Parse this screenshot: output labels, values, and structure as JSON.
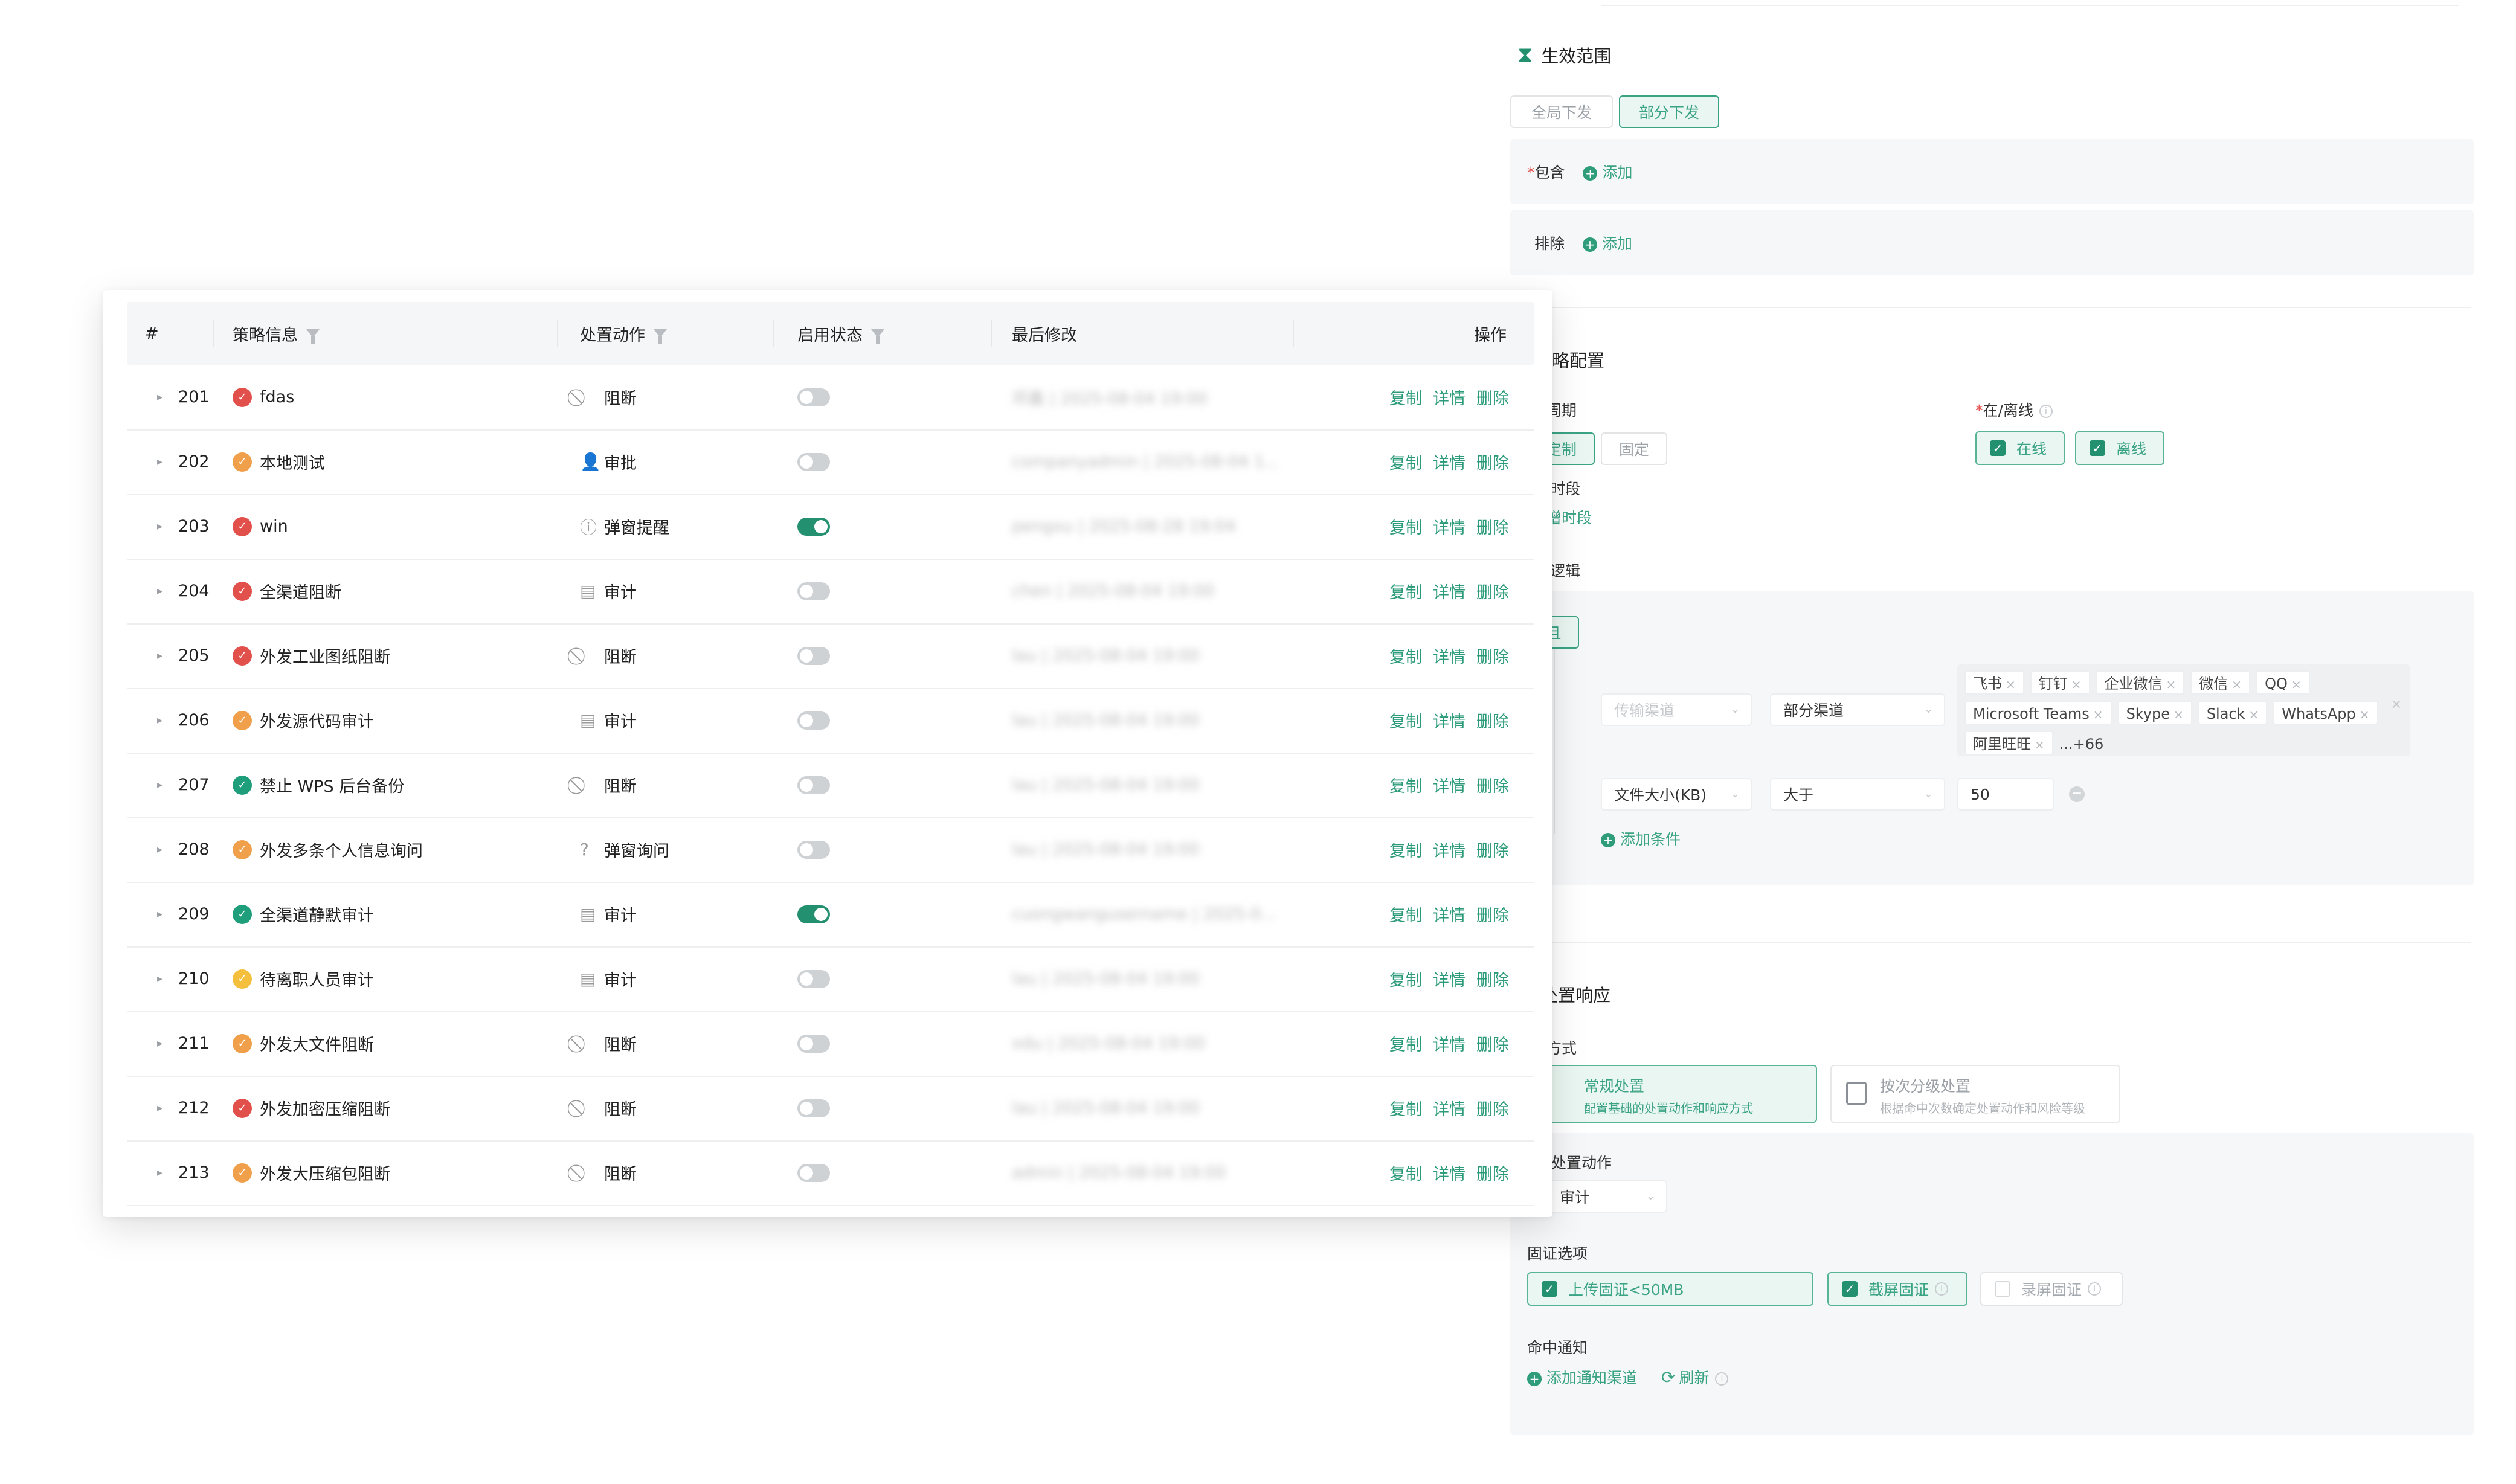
{
  "config": {
    "scope": {
      "title": "生效范围",
      "modes": [
        {
          "label": "全局下发",
          "active": false
        },
        {
          "label": "部分下发",
          "active": true
        }
      ],
      "include_label": "包含",
      "include_required": "*",
      "exclude_label": "排除",
      "add_label": "添加"
    },
    "strategy": {
      "title": "策略配置",
      "period_label": "周期",
      "period_options": [
        "定制",
        "固定"
      ],
      "online_label": "在/离线",
      "online_required": "*",
      "online_options": [
        "在线",
        "离线"
      ],
      "time_label": "时段",
      "time_add": "增时段",
      "logic_label": "逻辑",
      "logic_value": "且",
      "cond1_channel_placeholder": "传输渠道",
      "cond1_scope": "部分渠道",
      "cond1_tags": [
        "飞书",
        "钉钉",
        "企业微信",
        "微信",
        "QQ",
        "Microsoft Teams",
        "Skype",
        "Slack",
        "WhatsApp",
        "阿里旺旺"
      ],
      "cond1_more": "...+66",
      "cond2_field": "文件大小(KB)",
      "cond2_op": "大于",
      "cond2_value": "50",
      "add_condition": "添加条件"
    },
    "response": {
      "title": "处置响应",
      "method_label": "方式",
      "methods": [
        {
          "title": "常规处置",
          "desc": "配置基础的处置动作和响应方式",
          "active": true
        },
        {
          "title": "按次分级处置",
          "desc": "根据命中次数确定处置动作和风险等级",
          "active": false
        }
      ],
      "action_label": "处置动作",
      "action_value": "审计",
      "evidence_label": "固证选项",
      "evidence": [
        {
          "label": "上传固证<50MB",
          "checked": true
        },
        {
          "label": "截屏固证",
          "checked": true
        },
        {
          "label": "录屏固证",
          "checked": false
        }
      ],
      "notify_label": "命中通知",
      "notify_add": "添加通知渠道",
      "notify_refresh": "刷新"
    }
  },
  "table": {
    "headers": {
      "index": "#",
      "info": "策略信息",
      "action": "处置动作",
      "status": "启用状态",
      "modified": "最后修改",
      "ops": "操作"
    },
    "op_labels": {
      "copy": "复制",
      "detail": "详情",
      "delete": "删除"
    },
    "rows": [
      {
        "id": "201",
        "name": "fdas",
        "level": "red",
        "action": "阻断",
        "action_icon": "block-icon",
        "enabled": false,
        "modified": "邓鑫 | 2025-08-04 19:00"
      },
      {
        "id": "202",
        "name": "本地测试",
        "level": "orange",
        "action": "审批",
        "action_icon": "approval-icon",
        "enabled": false,
        "modified": "companyadmin | 2025-08-04 1..."
      },
      {
        "id": "203",
        "name": "win",
        "level": "red",
        "action": "弹窗提醒",
        "action_icon": "alert-icon",
        "enabled": true,
        "modified": "pengxu | 2025-08-28 19:04"
      },
      {
        "id": "204",
        "name": "全渠道阻断",
        "level": "red",
        "action": "审计",
        "action_icon": "audit-icon",
        "enabled": false,
        "modified": "chen | 2025-08-04 19:00"
      },
      {
        "id": "205",
        "name": "外发工业图纸阻断",
        "level": "red",
        "action": "阻断",
        "action_icon": "block-icon",
        "enabled": false,
        "modified": "lau | 2025-08-04 19:00"
      },
      {
        "id": "206",
        "name": "外发源代码审计",
        "level": "orange",
        "action": "审计",
        "action_icon": "audit-icon",
        "enabled": false,
        "modified": "lau | 2025-08-04 19:00"
      },
      {
        "id": "207",
        "name": "禁止 WPS 后台备份",
        "level": "green",
        "action": "阻断",
        "action_icon": "block-icon",
        "enabled": false,
        "modified": "lau | 2025-08-04 19:00"
      },
      {
        "id": "208",
        "name": "外发多条个人信息询问",
        "level": "orange",
        "action": "弹窗询问",
        "action_icon": "question-icon",
        "enabled": false,
        "modified": "lau | 2025-08-04 19:00"
      },
      {
        "id": "209",
        "name": "全渠道静默审计",
        "level": "green",
        "action": "审计",
        "action_icon": "audit-icon",
        "enabled": true,
        "modified": "cuongwangusername | 2025-0..."
      },
      {
        "id": "210",
        "name": "待离职人员审计",
        "level": "yellow",
        "action": "审计",
        "action_icon": "audit-icon",
        "enabled": false,
        "modified": "lau | 2025-08-04 19:00"
      },
      {
        "id": "211",
        "name": "外发大文件阻断",
        "level": "orange",
        "action": "阻断",
        "action_icon": "block-icon",
        "enabled": false,
        "modified": "xdu | 2025-08-04 19:00"
      },
      {
        "id": "212",
        "name": "外发加密压缩阻断",
        "level": "red",
        "action": "阻断",
        "action_icon": "block-icon",
        "enabled": false,
        "modified": "lau | 2025-08-04 19:00"
      },
      {
        "id": "213",
        "name": "外发大压缩包阻断",
        "level": "orange",
        "action": "阻断",
        "action_icon": "block-icon",
        "enabled": false,
        "modified": "admin | 2025-08-04 19:00"
      }
    ]
  },
  "colors": {
    "accent": "#23916f",
    "red": "#e2504c",
    "orange": "#f0a04b",
    "yellow": "#f3bf3c",
    "green": "#1e9e7a"
  }
}
